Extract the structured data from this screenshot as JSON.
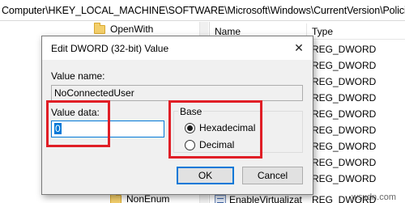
{
  "address": {
    "path": "Computer\\HKEY_LOCAL_MACHINE\\SOFTWARE\\Microsoft\\Windows\\CurrentVersion\\Policies\\"
  },
  "tree": {
    "items": [
      {
        "label": "OpenWith"
      },
      {
        "label": ""
      },
      {
        "label": ""
      },
      {
        "label": ""
      },
      {
        "label": ""
      },
      {
        "label": ""
      },
      {
        "label": ""
      },
      {
        "label": ""
      },
      {
        "label": ""
      },
      {
        "label": ""
      },
      {
        "label": "NonEnum"
      }
    ]
  },
  "values_list": {
    "headers": {
      "name": "Name",
      "type": "Type"
    },
    "rows": [
      {
        "name": "",
        "type": "REG_DWORD"
      },
      {
        "name": "",
        "type": "REG_DWORD"
      },
      {
        "name": "",
        "type": "REG_DWORD"
      },
      {
        "name": "",
        "type": "REG_DWORD"
      },
      {
        "name": "",
        "type": "REG_DWORD"
      },
      {
        "name": "",
        "type": "REG_DWORD"
      },
      {
        "name": "",
        "type": "REG_DWORD"
      },
      {
        "name": "",
        "type": "REG_DWORD"
      },
      {
        "name": "",
        "type": "REG_DWORD"
      },
      {
        "name": "EnableVirtualizat",
        "type": "REG_DWORD"
      }
    ]
  },
  "dialog": {
    "title": "Edit DWORD (32-bit) Value",
    "close_glyph": "✕",
    "value_name_label": "Value name:",
    "value_name": "NoConnectedUser",
    "value_data_label": "Value data:",
    "value_data": "0",
    "base_label": "Base",
    "base_options": [
      {
        "label": "Hexadecimal",
        "checked": true
      },
      {
        "label": "Decimal",
        "checked": false
      }
    ],
    "ok_label": "OK",
    "cancel_label": "Cancel"
  },
  "colors": {
    "annotation": "#e01e26",
    "accent": "#0078d7"
  },
  "watermark": "wsxdn.com"
}
